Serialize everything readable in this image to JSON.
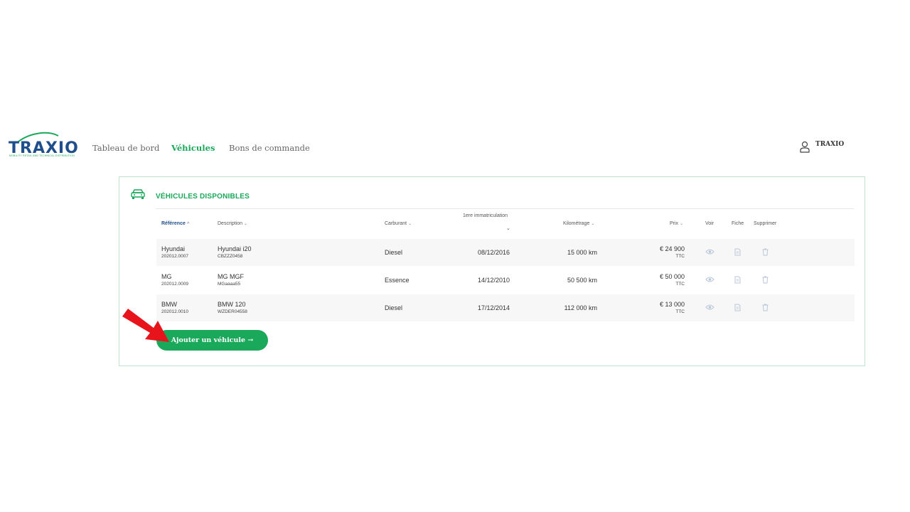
{
  "brand": {
    "name": "TRAXIO",
    "tagline": "MOBILITY RETAIL AND TECHNICAL DISTRIBUTION"
  },
  "nav": {
    "items": [
      "Tableau de bord",
      "Véhicules",
      "Bons de commande"
    ],
    "active": "Véhicules"
  },
  "user": {
    "name": "TRAXIO"
  },
  "card": {
    "title": "VÉHICULES DISPONIBLES",
    "columns": {
      "reference": "Référence",
      "description": "Description",
      "fuel": "Carburant",
      "registration": "1ere immatriculation",
      "mileage": "Kilométrage",
      "price": "Prix",
      "view": "Voir",
      "sheet": "Fiche",
      "delete": "Supprimer"
    },
    "rows": [
      {
        "make": "Hyundai",
        "ref": "202012.0007",
        "model": "Hyundai i20",
        "plate": "CBZZZ0458",
        "fuel": "Diesel",
        "date": "08/12/2016",
        "km": "15 000 km",
        "price": "€ 24 900",
        "tax": "TTC"
      },
      {
        "make": "MG",
        "ref": "202012.0009",
        "model": "MG MGF",
        "plate": "MGaaaa55",
        "fuel": "Essence",
        "date": "14/12/2010",
        "km": "50 500 km",
        "price": "€ 50 000",
        "tax": "TTC"
      },
      {
        "make": "BMW",
        "ref": "202012.0010",
        "model": "BMW 120",
        "plate": "WZDER04558",
        "fuel": "Diesel",
        "date": "17/12/2014",
        "km": "112 000 km",
        "price": "€ 13 000",
        "tax": "TTC"
      }
    ],
    "add_button": "Ajouter un véhicule  →"
  },
  "colors": {
    "accent": "#1aa85b",
    "brand_blue": "#1f4e8c",
    "border": "#bfe3d0",
    "row_bg": "#f7f7f7",
    "annotation_arrow": "#e8141b"
  }
}
